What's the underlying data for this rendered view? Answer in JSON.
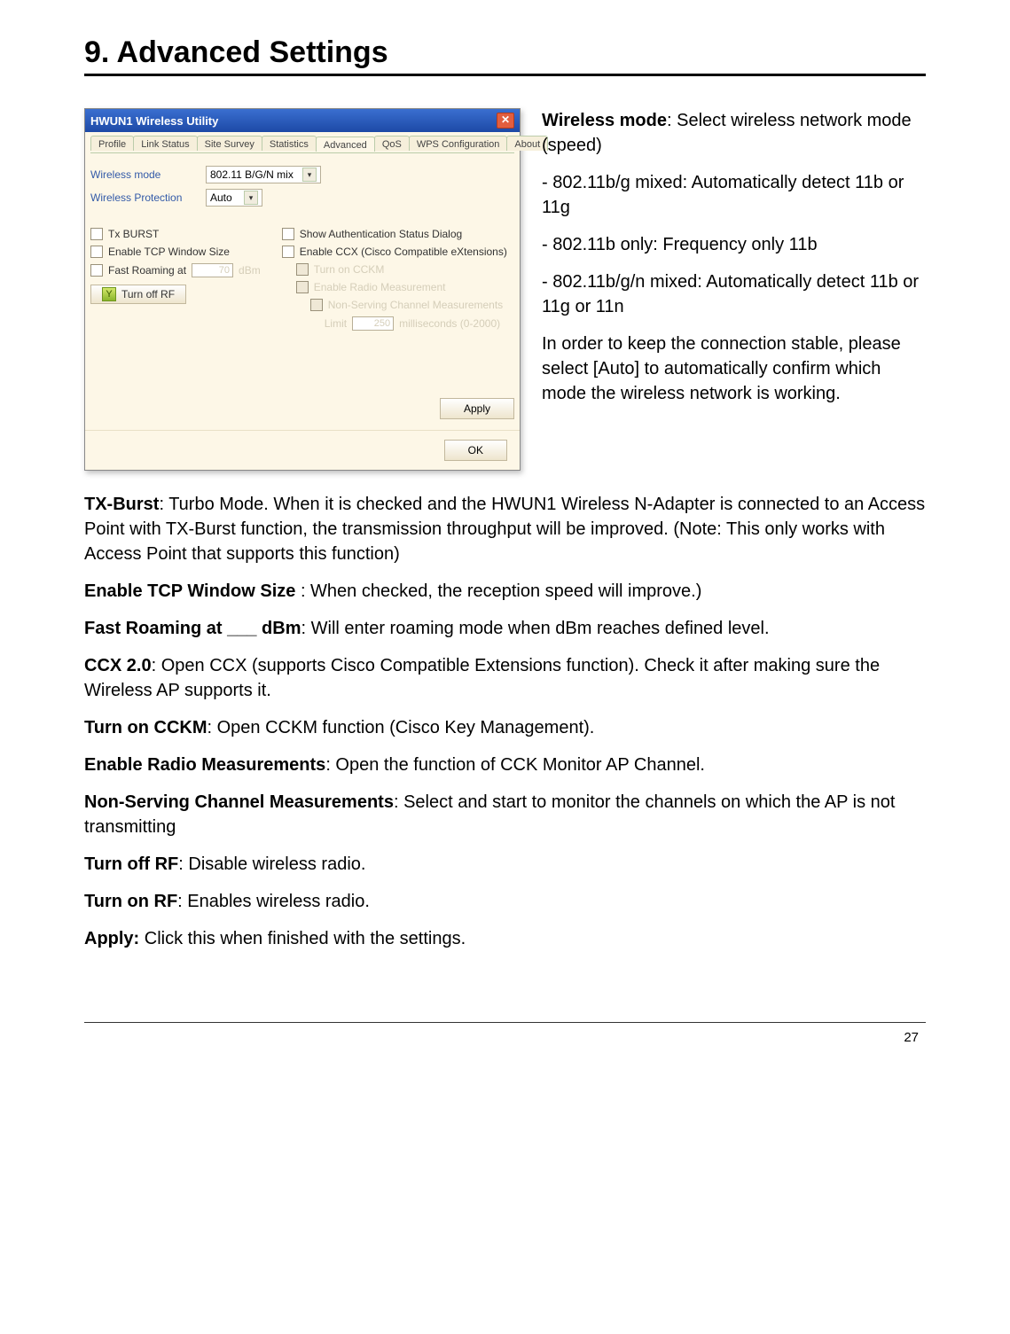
{
  "chapter_heading": "9.  Advanced Settings",
  "window": {
    "title": "HWUN1 Wireless Utility",
    "close_glyph": "✕",
    "tabs": [
      "Profile",
      "Link Status",
      "Site Survey",
      "Statistics",
      "Advanced",
      "QoS",
      "WPS Configuration",
      "About"
    ],
    "wireless_mode_label": "Wireless mode",
    "wireless_mode_value": "802.11 B/G/N mix",
    "wireless_protection_label": "Wireless Protection",
    "wireless_protection_value": "Auto",
    "col1": {
      "txburst": "Tx BURST",
      "tcpwin": "Enable TCP Window Size",
      "fastroam_pre": "Fast Roaming at",
      "fastroam_val": "70",
      "fastroam_unit": "dBm",
      "turn_btn": "Turn off RF"
    },
    "col2": {
      "authdlg": "Show Authentication Status Dialog",
      "ccx": "Enable CCX (Cisco Compatible eXtensions)",
      "cckm": "Turn on CCKM",
      "radiomeas": "Enable Radio Measurement",
      "nonserv": "Non-Serving Channel Measurements",
      "limit_pre": "Limit",
      "limit_val": "250",
      "limit_post": "milliseconds (0-2000)"
    },
    "apply": "Apply",
    "ok": "OK"
  },
  "side": {
    "p1_bold": "Wireless mode",
    "p1_rest": ": Select wireless network mode (speed)",
    "p2": "- 802.11b/g mixed: Automatically detect 11b or 11g",
    "p3": "- 802.11b only: Frequency only 11b",
    "p4": "- 802.11b/g/n mixed: Automatically detect 11b or 11g or 11n",
    "p5": "In order to keep the connection stable, please select [Auto] to automatically confirm which mode the wireless network is working."
  },
  "body": {
    "p1_bold": "TX-Burst",
    "p1_rest": ": Turbo Mode.   When it is checked and the HWUN1 Wireless N-Adapter is connected to an Access Point with TX-Burst function,  the transmission throughput will be improved. (Note: This only works with Access Point that supports this function)",
    "p2_bold": "Enable TCP Window Size ",
    "p2_rest": ": When checked, the reception speed will improve.)",
    "p3_bold": "Fast Roaming at ___ dBm",
    "p3_rest": ": Will enter roaming mode when dBm reaches defined level.",
    "p4_bold": "CCX 2.0",
    "p4_rest": ": Open CCX (supports Cisco Compatible Extensions function). Check it after making sure the Wireless AP supports it.",
    "p5_bold": "Turn on CCKM",
    "p5_rest": ": Open CCKM function (Cisco Key Management).",
    "p6_bold": "Enable Radio Measurements",
    "p6_rest": ": Open the function of CCK Monitor AP Channel.",
    "p7_bold": "Non-Serving Channel Measurements",
    "p7_rest": ": Select and start to monitor the channels on which the AP is not transmitting",
    "p8_bold": "Turn off RF",
    "p8_rest": ": Disable wireless radio.",
    "p9_bold": "Turn on RF",
    "p9_rest": ": Enables wireless radio.",
    "p10_bold": "Apply:",
    "p10_rest": " Click this when finished with the settings."
  },
  "page_number": "27"
}
